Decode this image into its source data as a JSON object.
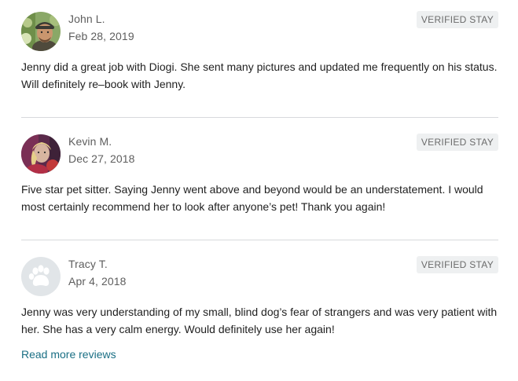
{
  "reviews": [
    {
      "name": "John L.",
      "date": "Feb 28, 2019",
      "badge": "VERIFIED STAY",
      "text": "Jenny did a great job with Diogi. She sent many pictures and updated me frequently on his status. Will definitely re–book with Jenny.",
      "avatar": "photo-avatar"
    },
    {
      "name": "Kevin M.",
      "date": "Dec 27, 2018",
      "badge": "VERIFIED STAY",
      "text": "Five star pet sitter. Saying Jenny went above and beyond would be an understatement. I would most certainly recommend her to look after anyone’s pet! Thank you again!",
      "avatar": "photo-avatar"
    },
    {
      "name": "Tracy T.",
      "date": "Apr 4, 2018",
      "badge": "VERIFIED STAY",
      "text": "Jenny was very understanding of my small, blind dog’s fear of strangers and was very patient with her. She has a very calm energy. Would definitely use her again!",
      "avatar": "paw-placeholder-icon"
    }
  ],
  "read_more_label": "Read more reviews",
  "colors": {
    "text": "#1f1f1f",
    "muted": "#5e5e5e",
    "badge_bg": "#eef0f1",
    "link": "#1a6f84",
    "divider": "#d7d9dc"
  }
}
